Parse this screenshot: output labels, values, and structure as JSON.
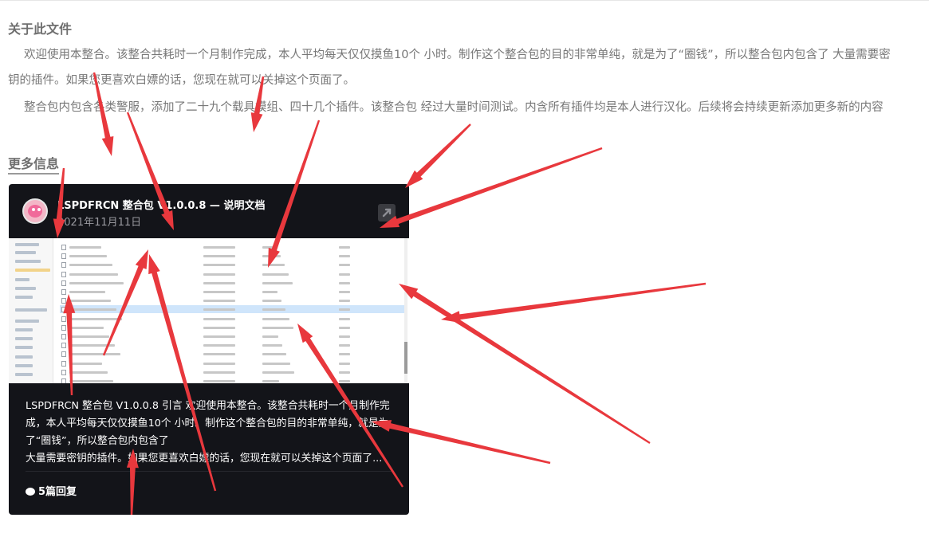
{
  "about": {
    "title": "关于此文件",
    "paragraph1": "欢迎使用本整合。该整合共耗时一个月制作完成，本人平均每天仅仅摸鱼10个 小时。制作这个整合包的目的非常单纯，就是为了“圈钱”，所以整合包内包含了 大量需要密钥的插件。如果您更喜欢白嫖的话，您现在就可以关掉这个页面了。",
    "paragraph2": "整合包内包含各类警服，添加了二十九个载具模组、四十几个插件。该整合包 经过大量时间测试。内含所有插件均是本人进行汉化。后续将会持续更新添加更多新的内容"
  },
  "more": {
    "title": "更多信息"
  },
  "embed": {
    "title": "LSPDFRCN 整合包 V1.0.0.8 — 说明文档",
    "date": "2021年11月11日",
    "description_line1": "LSPDFRCN 整合包 V1.0.0.8 引言 欢迎使用本整合。该整合共耗时一个月制作完成，本人平均每天仅仅摸鱼10个 小时。制作这个整合包的目的非常单纯，就是为了“圈钱”，所以整合包内包含了",
    "description_line2": "大量需要密钥的插件。如果您更喜欢白嫖的话，您现在就可以关掉这个页面了...",
    "replies": "5篇回复"
  },
  "colors": {
    "card_bg": "#131419",
    "annotation_arrow": "#e8383d"
  }
}
